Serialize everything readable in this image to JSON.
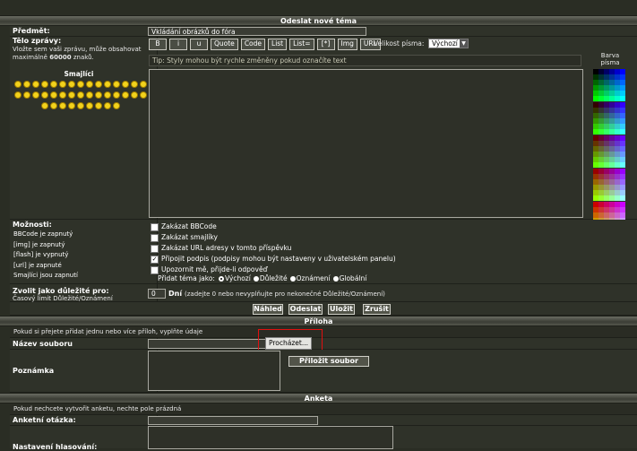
{
  "header": {
    "title": "Odeslat nové téma"
  },
  "subject": {
    "label": "Předmět:",
    "value": "Vkládání obrázků do fóra"
  },
  "body": {
    "label": "Tělo zprávy:",
    "hint_pre": "Vložte sem vaši zprávu, může obsahovat maximálně",
    "hint_max": "60000",
    "hint_post": "znaků.",
    "smileys_label": "Smajlíci",
    "smiley_count": 39,
    "buttons": [
      "B",
      "i",
      "u",
      "Quote",
      "Code",
      "List",
      "List=",
      "[*]",
      "Img",
      "URL"
    ],
    "font_size_label": "Velikost písma:",
    "font_size_value": "Výchozí",
    "tip": "Tip: Styly mohou být rychle změněny pokud označíte text",
    "color_label": "Barva písma"
  },
  "options": {
    "label": "Možnosti:",
    "status": [
      "BBCode je zapnutý",
      "[img] je zapnutý",
      "[flash] je vypnutý",
      "[url] je zapnuté",
      "Smajlíci jsou zapnutí"
    ],
    "checks": [
      {
        "label": "Zakázat BBCode",
        "checked": false
      },
      {
        "label": "Zakázat smajlíky",
        "checked": false
      },
      {
        "label": "Zakázat URL adresy v tomto příspěvku",
        "checked": false
      },
      {
        "label": "Připojit podpis (podpisy mohou být nastaveny v uživatelském panelu)",
        "checked": true
      },
      {
        "label": "Upozornit mě, přijde-li odpověď",
        "checked": false
      }
    ],
    "post_as_label": "Přidat téma jako:",
    "post_as": [
      "Výchozí",
      "Důležité",
      "Oznámení",
      "Globální"
    ]
  },
  "sticky": {
    "label": "Zvolit jako důležité pro:",
    "sub": "Časový limit Důležité/Oznámení",
    "value": "0",
    "unit": "Dní",
    "hint": "(zadejte 0 nebo nevyplňujte pro nekonečné Důležité/Oznámení)"
  },
  "actions": [
    "Náhled",
    "Odeslat",
    "Uložit",
    "Zrušit"
  ],
  "attach": {
    "title": "Příloha",
    "note": "Pokud si přejete přidat jednu nebo více příloh, vyplňte údaje",
    "file_label": "Název souboru",
    "browse": "Procházet...",
    "comment_label": "Poznámka",
    "add_button": "Přiložit soubor"
  },
  "poll": {
    "title": "Anketa",
    "note": "Pokud nechcete vytvořit anketu, nechte pole prázdná",
    "question_label": "Anketní otázka:",
    "options_label": "Nastavení hlasování:"
  },
  "colors": {
    "highlight": "#e01010"
  }
}
